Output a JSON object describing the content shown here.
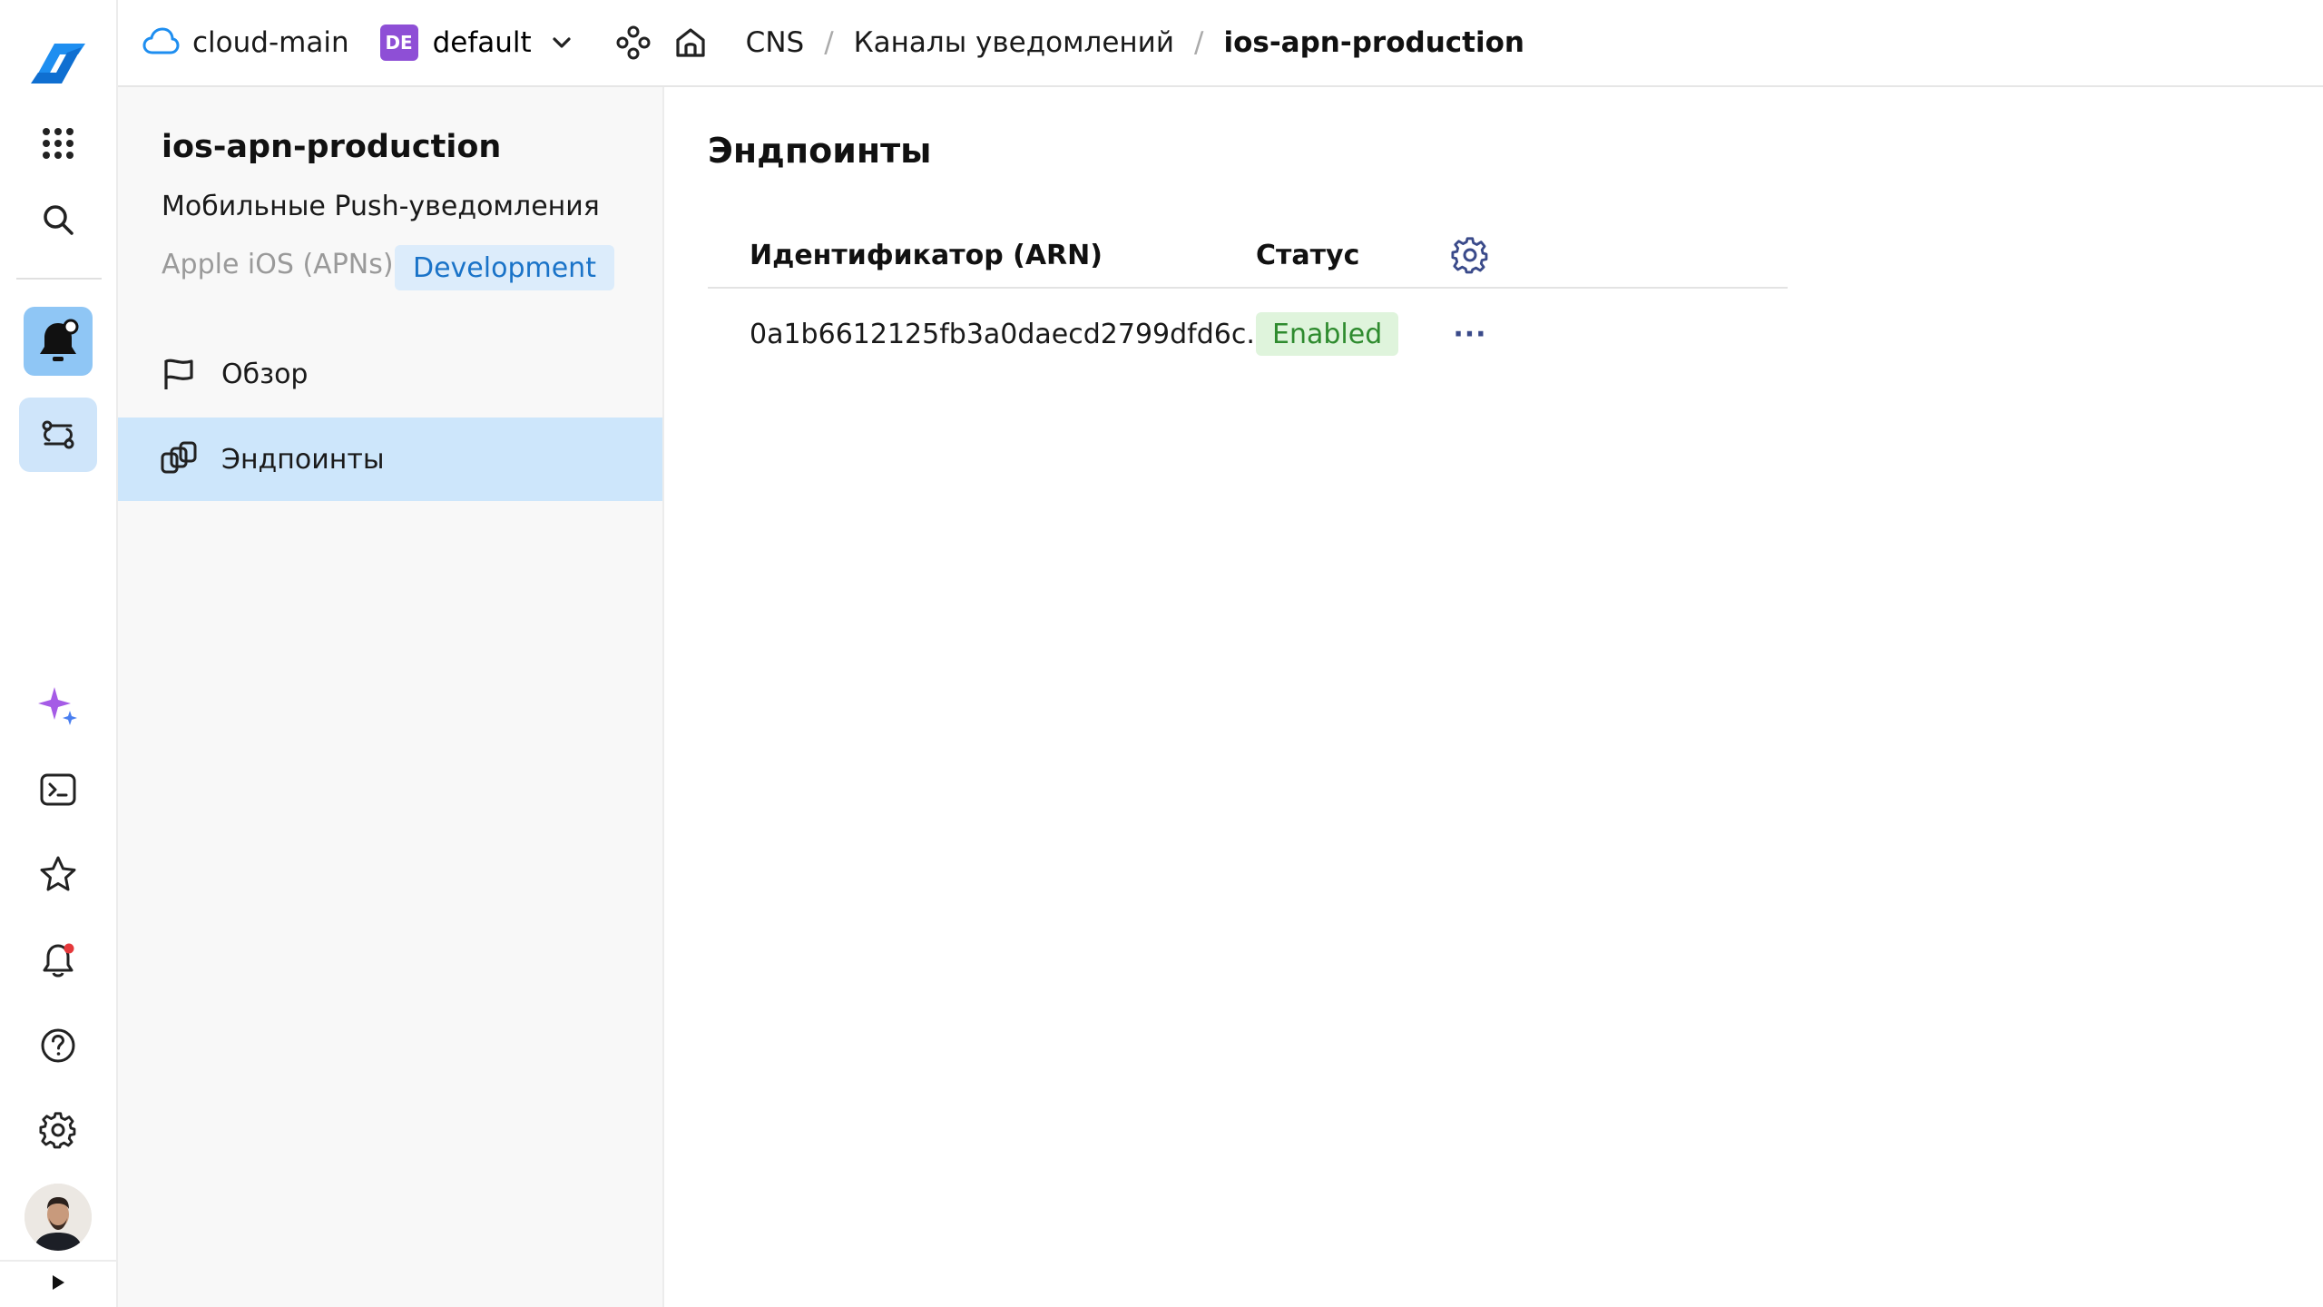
{
  "topbar": {
    "cloud_name": "cloud-main",
    "folder_badge": "DE",
    "folder_name": "default",
    "breadcrumbs": [
      "CNS",
      "Каналы уведомлений",
      "ios-apn-production"
    ],
    "breadcrumb_sep": "/"
  },
  "sidebar": {
    "title": "ios-apn-production",
    "subtitle": "Мобильные Push-уведомления",
    "platform": "Apple iOS (APNs)",
    "env_badge": "Development",
    "items": [
      {
        "label": "Обзор",
        "icon": "flag-icon"
      },
      {
        "label": "Эндпоинты",
        "icon": "endpoints-icon"
      }
    ]
  },
  "main": {
    "title": "Эндпоинты",
    "table": {
      "headers": [
        "Идентификатор (ARN)",
        "Статус"
      ],
      "rows": [
        {
          "arn": "0a1b6612125fb3a0daecd2799dfd6c...",
          "status": "Enabled",
          "more": "···"
        }
      ]
    }
  },
  "colors": {
    "accent": "#1a73c8",
    "active_nav": "#cde6fb",
    "status_enabled_bg": "#dff4dc",
    "status_enabled_fg": "#2e8b2e",
    "folder_badge": "#8e4fd6"
  }
}
